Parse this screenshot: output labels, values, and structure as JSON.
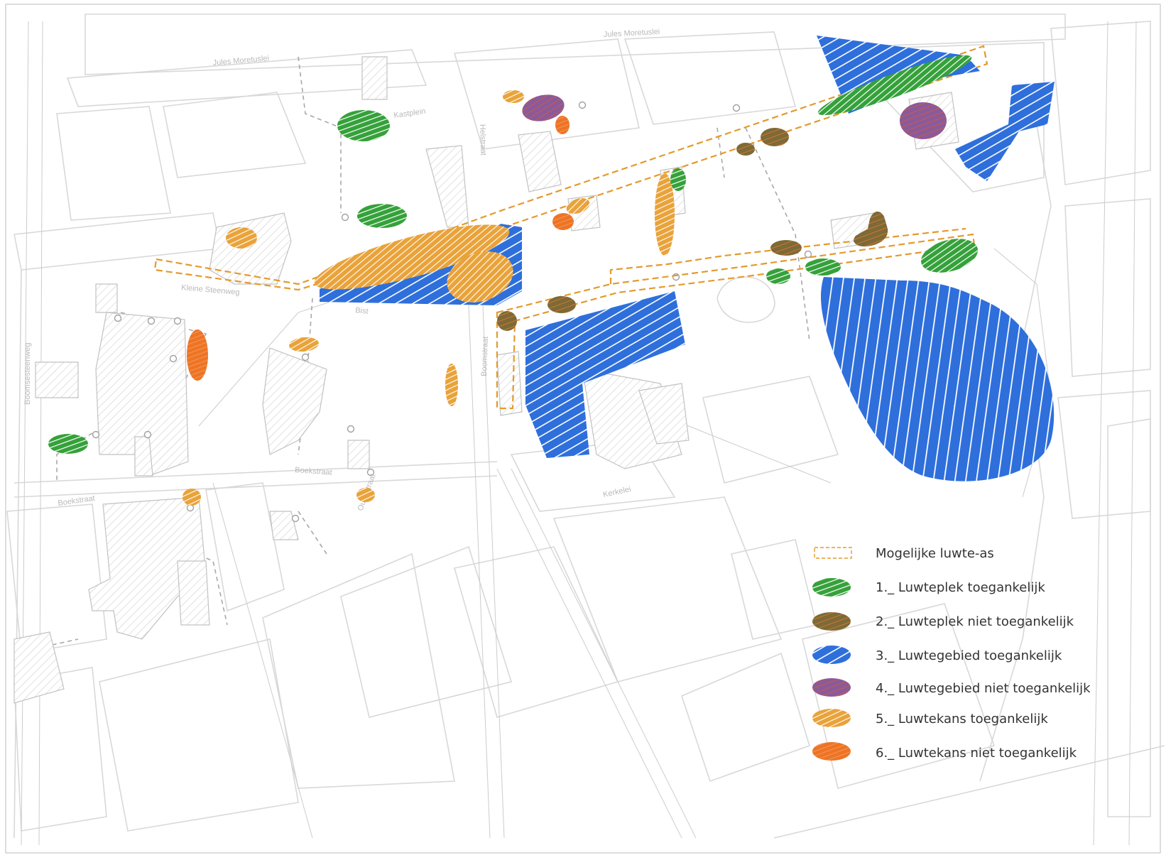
{
  "colors": {
    "green": "#35a13a",
    "brown": "#8a6f3a",
    "blue": "#2e6fdb",
    "purple": "#8a5a9a",
    "amber": "#e9a33a",
    "orange": "#ee7424",
    "street": "#d6d6d6",
    "hatch": "#bdbdbd",
    "axis": "#e39a2c"
  },
  "streets": {
    "jules_moretuslei_1": "Jules Moretuslei",
    "jules_moretuslei_2": "Jules Moretuslei",
    "kleine_steenweg": "Kleine Steenweg",
    "bist": "Bist",
    "boomsesteenweg": "Boomsesteenweg",
    "boekstraat_1": "Boekstraat",
    "boekstraat_2": "Boekstraat",
    "oudestraat": "Oudestraat",
    "kerkelei": "Kerkelei",
    "boomstraat": "Boomstraat",
    "kastplein": "Kastplein",
    "helstraat": "Helstraat"
  },
  "legend": {
    "axis_label": "Mogelijke luwte-as",
    "items": [
      {
        "label": "1._ Luwteplek toegankelijk",
        "icon": "green-hatched-ellipse",
        "color": "#35a13a"
      },
      {
        "label": "2._ Luwteplek niet toegankelijk",
        "icon": "brown-hatched-ellipse",
        "color": "#8a6f3a"
      },
      {
        "label": "3._ Luwtegebied toegankelijk",
        "icon": "blue-hatched-ellipse",
        "color": "#2e6fdb"
      },
      {
        "label": "4._ Luwtegebied niet toegankelijk",
        "icon": "purple-hatched-ellipse",
        "color": "#8a5a9a"
      },
      {
        "label": "5._ Luwtekans toegankelijk",
        "icon": "amber-hatched-ellipse",
        "color": "#e9a33a"
      },
      {
        "label": "6._ Luwtekans niet toegankelijk",
        "icon": "orange-hatched-ellipse",
        "color": "#ee7424"
      }
    ]
  }
}
